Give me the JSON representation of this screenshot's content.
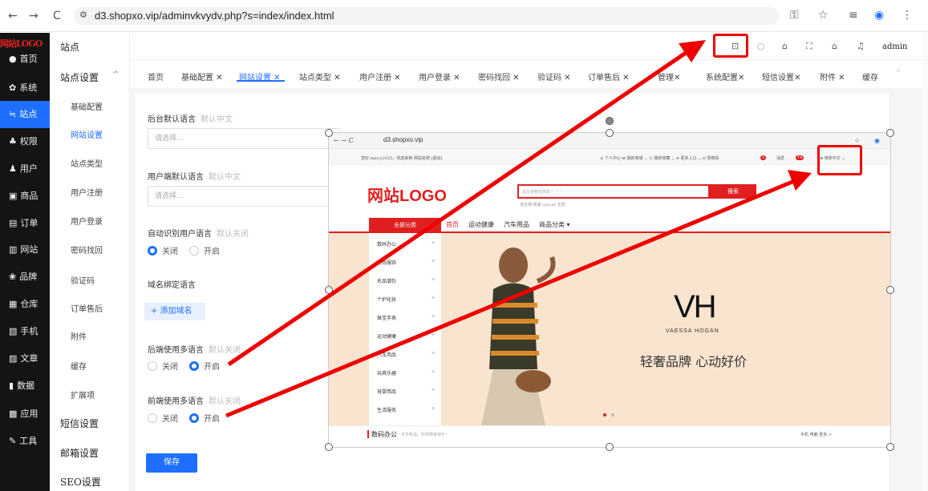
{
  "browser": {
    "url": "d3.shopxo.vip/adminvkvydv.php?s=index/index.html",
    "back": "←",
    "forward": "→",
    "reload": "C",
    "icons": [
      "key-icon",
      "star-icon",
      "playlist-icon",
      "profile-icon",
      "menu-dots-icon"
    ]
  },
  "sidebar": {
    "logo": "网站LOGO",
    "items": [
      {
        "icon": "●",
        "label": "首页"
      },
      {
        "icon": "✿",
        "label": "系统"
      },
      {
        "icon": "≒",
        "label": "站点"
      },
      {
        "icon": "♣",
        "label": "权限"
      },
      {
        "icon": "♟",
        "label": "用户"
      },
      {
        "icon": "▣",
        "label": "商品"
      },
      {
        "icon": "▤",
        "label": "订单"
      },
      {
        "icon": "▥",
        "label": "网站"
      },
      {
        "icon": "❀",
        "label": "品牌"
      },
      {
        "icon": "▦",
        "label": "仓库"
      },
      {
        "icon": "▧",
        "label": "手机"
      },
      {
        "icon": "▨",
        "label": "文章"
      },
      {
        "icon": "▮",
        "label": "数据"
      },
      {
        "icon": "▩",
        "label": "应用"
      },
      {
        "icon": "✎",
        "label": "工具"
      }
    ]
  },
  "menu2": {
    "title": "站点",
    "group": "站点设置",
    "group_chevron": "^",
    "items": [
      "基础配置",
      "网站设置",
      "站点类型",
      "用户注册",
      "用户登录",
      "密码找回",
      "验证码",
      "订单售后",
      "附件",
      "缓存",
      "扩展项"
    ],
    "sms": "短信设置",
    "mail": "邮箱设置",
    "seo": "SEO设置"
  },
  "topbar": {
    "admin": "admin",
    "icons": [
      "translate-icon",
      "palette-icon",
      "store-icon",
      "fullscreen-icon",
      "home-icon",
      "bell-icon"
    ]
  },
  "tabs": [
    "首页",
    "基础配置 ✕",
    "网站设置 ✕",
    "站点类型 ✕",
    "用户注册 ✕",
    "用户登录 ✕",
    "密码找回 ✕",
    "验证码 ✕",
    "订单售后 ✕",
    "管理✕",
    "系统配置✕",
    "短信设置✕",
    "附件 ✕",
    "缓存"
  ],
  "form": {
    "admin_lang_label": "后台默认语言",
    "admin_lang_hint": "默认中文",
    "select_placeholder": "请选择...",
    "user_lang_label": "用户端默认语言",
    "user_lang_hint": "默认中文",
    "auto_lang_label": "自动识别用户语言",
    "auto_lang_hint": "默认关闭",
    "off": "关闭",
    "on": "开启",
    "domain_lang_label": "域名绑定语言",
    "add_domain": "+ 添加域名",
    "backend_multi_label": "后端使用多语言",
    "backend_multi_hint": "默认关闭",
    "frontend_multi_label": "前端使用多语言",
    "frontend_multi_hint": "默认关闭",
    "save": "保存"
  },
  "shot": {
    "url": "d3.shopxo.vip",
    "welcome": "您好 nancy2025，欢迎来到 网站名称 [退出]",
    "toplinks": "♙ 个人中心   ⊟ 我的商城 ⌄   ☆ 我的收藏 ⌄   ⊖ 更多入口 ⌄   ⊡ 购物车",
    "cart_count": "3",
    "msg": "消息",
    "msg_count": "14",
    "lang": "⊕ 简体中文 ⌄",
    "logo": "网站LOGO",
    "search_placeholder": "其实搜索很简单^_^ !",
    "search_hot": "连衣裙  帐篷  iphone  包包",
    "search_btn": "搜索",
    "all_categories": "全部分类",
    "nav": [
      "首页",
      "运动健康",
      "汽车用品",
      "商品分类 ▾"
    ],
    "categories": [
      "数码办公",
      "时尚服饰",
      "名品潮包",
      "个护化妆",
      "珠宝手表",
      "运动健康",
      "汽车用品",
      "玩具乐器",
      "母婴用品",
      "生活服务"
    ],
    "banner_brand": "VH",
    "banner_brand_sub": "VAESSA HOGAN",
    "banner_slogan": "轻奢品牌 心动好价",
    "footer_title": "数码办公",
    "footer_sub": "天天新品，科技带来快乐！",
    "footer_links": "手机  电脑  更多 >"
  }
}
